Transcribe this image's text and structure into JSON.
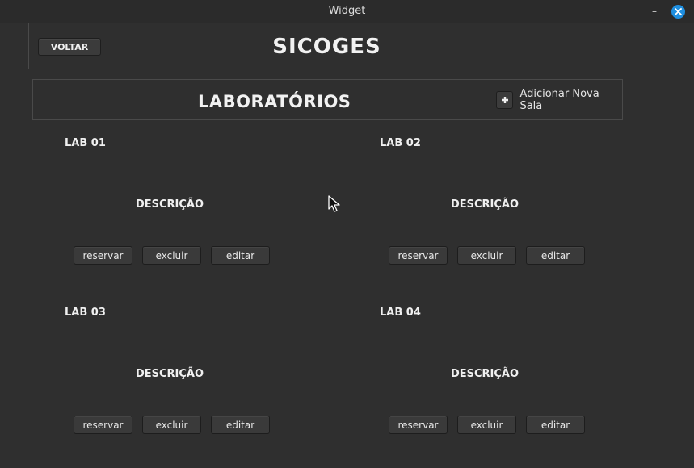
{
  "window": {
    "title": "Widget",
    "minimize_glyph": "–",
    "close_icon": "close-icon",
    "accent": "#1f8fe0"
  },
  "header": {
    "back_label": "VOLTAR",
    "app_title": "SICOGES"
  },
  "section": {
    "title": "LABORATÓRIOS",
    "add_label": "Adicionar Nova Sala",
    "add_icon": "plus-icon"
  },
  "labs": [
    {
      "name": "LAB 01",
      "description": "DESCRIÇÃO",
      "reserve": "reservar",
      "delete": "excluir",
      "edit": "editar"
    },
    {
      "name": "LAB 02",
      "description": "DESCRIÇÃO",
      "reserve": "reservar",
      "delete": "excluir",
      "edit": "editar"
    },
    {
      "name": "LAB 03",
      "description": "DESCRIÇÃO",
      "reserve": "reservar",
      "delete": "excluir",
      "edit": "editar"
    },
    {
      "name": "LAB 04",
      "description": "DESCRIÇÃO",
      "reserve": "reservar",
      "delete": "excluir",
      "edit": "editar"
    }
  ]
}
